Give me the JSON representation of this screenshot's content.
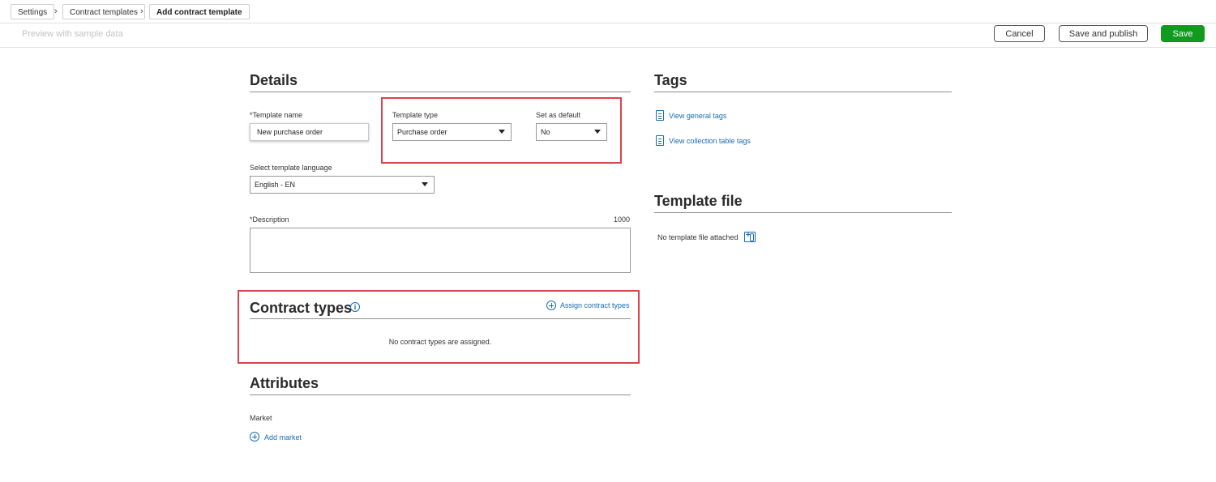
{
  "breadcrumb": {
    "items": [
      "Settings",
      "Contract templates",
      "Add contract template"
    ]
  },
  "toolbar": {
    "preview_label": "Preview with sample data",
    "cancel_label": "Cancel",
    "save_publish_label": "Save and publish",
    "save_label": "Save"
  },
  "details": {
    "title": "Details",
    "template_name_label": "*Template name",
    "template_name_value": "New purchase order",
    "template_type_label": "Template type",
    "template_type_value": "Purchase order",
    "default_label": "Set as default",
    "default_value": "No",
    "language_label": "Select template language",
    "language_value": "English - EN",
    "description_label": "*Description",
    "description_counter": "1000",
    "description_value": ""
  },
  "contract_types": {
    "title": "Contract types",
    "assign_label": "Assign contract types",
    "empty_text": "No contract types are assigned."
  },
  "attributes": {
    "title": "Attributes",
    "market_label": "Market",
    "add_market_label": "Add market"
  },
  "tags": {
    "title": "Tags",
    "general_link": "View general tags",
    "collection_link": "View collection table tags"
  },
  "template_file": {
    "title": "Template file",
    "status_text": "No template file attached"
  },
  "colors": {
    "primary_button": "#119a1d",
    "link": "#1a6bb0",
    "highlight_box": "#d9434d"
  }
}
